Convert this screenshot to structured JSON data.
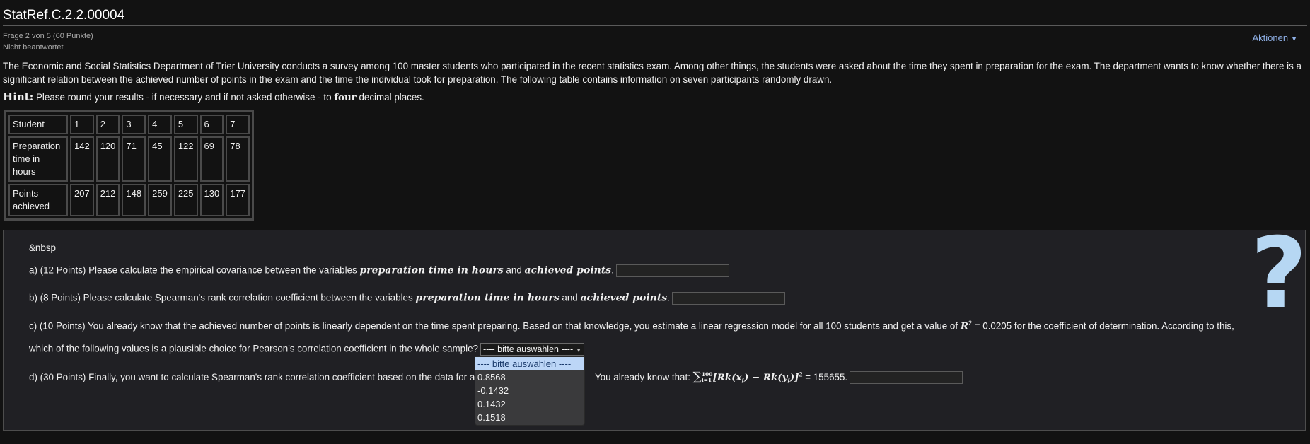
{
  "header": {
    "title": "StatRef.C.2.2.00004",
    "question_info": "Frage 2 von 5 (60 Punkte)",
    "status": "Nicht beantwortet",
    "actions_label": "Aktionen"
  },
  "intro": {
    "text": "The Economic and Social Statistics Department of Trier University conducts a survey among 100 master students who participated in the recent statistics exam. Among other things, the students were asked about the time they spent in preparation for the exam. The department wants to know whether there is a significant relation between the achieved number of points in the exam and the time the individual took for preparation. The following table contains information on seven participants randomly drawn.",
    "hint_label": "Hint:",
    "hint_before": " Please round your results - if necessary and if not asked otherwise - to ",
    "hint_bold": "four",
    "hint_after": " decimal places."
  },
  "table": {
    "rows": [
      {
        "label": "Student",
        "values": [
          "1",
          "2",
          "3",
          "4",
          "5",
          "6",
          "7"
        ]
      },
      {
        "label": "Preparation time in hours",
        "values": [
          "142",
          "120",
          "71",
          "45",
          "122",
          "69",
          "78"
        ]
      },
      {
        "label": "Points achieved",
        "values": [
          "207",
          "212",
          "148",
          "259",
          "225",
          "130",
          "177"
        ]
      }
    ]
  },
  "questions": {
    "nbsp": "&nbsp",
    "a_pre": "a) (12 Points) Please calculate the empirical covariance between the variables ",
    "a_var1": "preparation time in hours",
    "a_and": " and ",
    "a_var2": "achieved points",
    "a_post": ".",
    "b_pre": "b) (8 Points) Please calculate Spearman's rank correlation coefficient between the variables ",
    "b_var1": "preparation time in hours",
    "b_and": " and ",
    "b_var2": "achieved points",
    "b_post": ".",
    "c_line1_pre": "c) (10 Points) You already know that the achieved number of points is linearly dependent on the time spent preparing. Based on that knowledge, you estimate a linear regression model for all 100 students and get a value of ",
    "c_r2": "R",
    "c_r2_sup": "2",
    "c_eq": " = ",
    "c_line1_post": "0.0205 for the coefficient of determination. According to this,",
    "c_line2": "which of the following values is a plausible choice for Pearson's correlation coefficient in the whole sample?",
    "c_select_value": "---- bitte auswählen ----",
    "d_pre": "d) (30 Points) Finally, you want to calculate Spearman's rank correlation coefficient based on the data for all ",
    "d_mid": "You already know that: ",
    "d_sum": "∑",
    "d_sum_sup": "100",
    "d_sum_sub": "i=1",
    "d_formula": "[Rk(x",
    "d_formula_i": "i",
    "d_formula2": ") − Rk(y",
    "d_formula_i2": "i",
    "d_formula3": ")]",
    "d_sq": "2",
    "d_post": " = 155655."
  },
  "dropdown": {
    "options": [
      "---- bitte auswählen ----",
      "0.8568",
      "-0.1432",
      "0.1432",
      "0.1518"
    ],
    "selected_index": 0
  },
  "help_icon": "question-mark-icon",
  "colors": {
    "background": "#121212",
    "panel": "#202024",
    "accent_link": "#8fb0e6",
    "help_icon": "#b6d7f3",
    "selected_option": "#bcd6f7"
  }
}
